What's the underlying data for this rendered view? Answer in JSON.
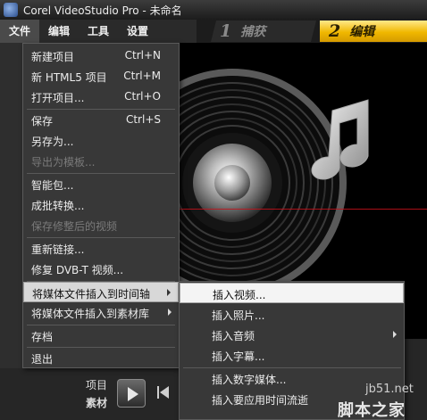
{
  "window": {
    "title": "Corel VideoStudio Pro - 未命名"
  },
  "menubar": {
    "items": [
      "文件",
      "编辑",
      "工具",
      "设置"
    ]
  },
  "steps": [
    {
      "num": "1",
      "label": "捕获",
      "active": false
    },
    {
      "num": "2",
      "label": "编辑",
      "active": true
    }
  ],
  "file_menu": {
    "items": [
      {
        "label": "新建项目",
        "shortcut": "Ctrl+N"
      },
      {
        "label": "新 HTML5 项目",
        "shortcut": "Ctrl+M"
      },
      {
        "label": "打开项目...",
        "shortcut": "Ctrl+O"
      },
      {
        "label": "保存",
        "shortcut": "Ctrl+S"
      },
      {
        "label": "另存为...",
        "shortcut": ""
      },
      {
        "label": "导出为模板...",
        "shortcut": ""
      },
      {
        "label": "智能包...",
        "shortcut": ""
      },
      {
        "label": "成批转换...",
        "shortcut": ""
      },
      {
        "label": "保存修整后的视频",
        "shortcut": ""
      },
      {
        "label": "重新链接...",
        "shortcut": ""
      },
      {
        "label": "修复 DVB-T 视频...",
        "shortcut": ""
      },
      {
        "label": "将媒体文件插入到时间轴",
        "shortcut": ""
      },
      {
        "label": "将媒体文件插入到素材库",
        "shortcut": ""
      },
      {
        "label": "存档",
        "shortcut": ""
      },
      {
        "label": "退出",
        "shortcut": ""
      }
    ]
  },
  "submenu": {
    "items": [
      {
        "label": "插入视频..."
      },
      {
        "label": "插入照片..."
      },
      {
        "label": "插入音频"
      },
      {
        "label": "插入字幕..."
      },
      {
        "label": "插入数字媒体..."
      },
      {
        "label": "插入要应用时间流逝"
      }
    ]
  },
  "playback": {
    "project_label": "项目",
    "clip_label": "素材"
  },
  "watermark": {
    "site": "jb51.net",
    "name": "脚本之家"
  },
  "colors": {
    "edit_step": "#f0b800",
    "accent_line": "#c8101a",
    "menu_bg": "#383838"
  }
}
